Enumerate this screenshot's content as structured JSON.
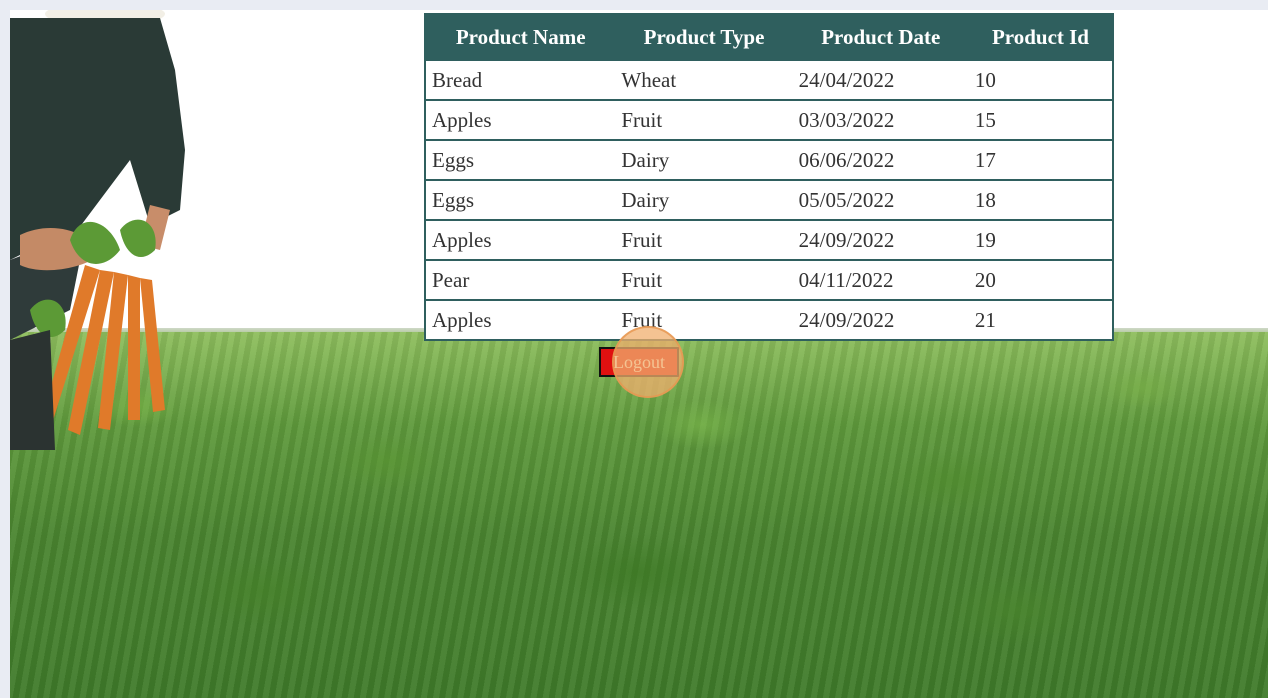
{
  "table": {
    "headers": [
      "Product Name",
      "Product Type",
      "Product Date",
      "Product Id"
    ],
    "rows": [
      [
        "Bread",
        "Wheat",
        "24/04/2022",
        "10"
      ],
      [
        "Apples",
        "Fruit",
        "03/03/2022",
        "15"
      ],
      [
        "Eggs",
        "Dairy",
        "06/06/2022",
        "17"
      ],
      [
        "Eggs",
        "Dairy",
        "05/05/2022",
        "18"
      ],
      [
        "Apples",
        "Fruit",
        "24/09/2022",
        "19"
      ],
      [
        "Pear",
        "Fruit",
        "04/11/2022",
        "20"
      ],
      [
        "Apples",
        "Fruit",
        "24/09/2022",
        "21"
      ]
    ]
  },
  "logout": {
    "label": "Logout"
  },
  "colors": {
    "header_bg": "#2f5f5e",
    "logout_bg": "#e01010",
    "click_marker": "#f0af6e"
  },
  "background": {
    "subject": "farmer holding carrots in carrot field"
  }
}
